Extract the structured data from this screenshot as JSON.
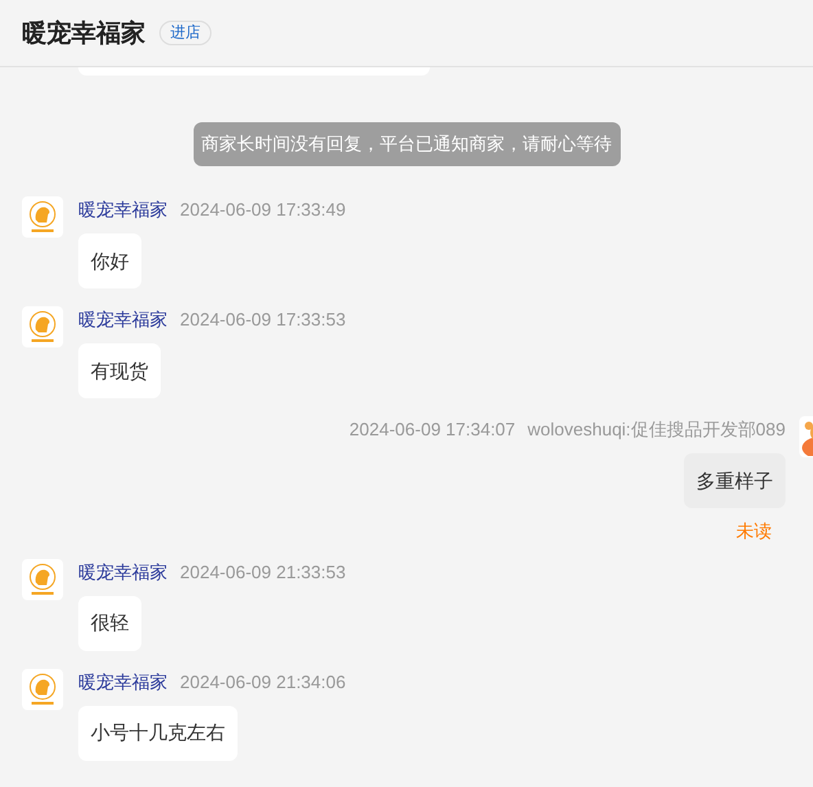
{
  "header": {
    "title": "暖宠幸福家",
    "shop_button": "进店"
  },
  "messages": [
    {
      "kind": "notice",
      "text": "商家长时间没有回复，平台已通知商家，请耐心等待"
    },
    {
      "kind": "shop",
      "sender": "暖宠幸福家",
      "time": "2024-06-09 17:33:49",
      "text": "你好"
    },
    {
      "kind": "shop",
      "sender": "暖宠幸福家",
      "time": "2024-06-09 17:33:53",
      "text": "有现货"
    },
    {
      "kind": "self",
      "sender": "woloveshuqi:促佳搜品开发部089",
      "time": "2024-06-09 17:34:07",
      "text": "多重样子",
      "status": "未读"
    },
    {
      "kind": "shop",
      "sender": "暖宠幸福家",
      "time": "2024-06-09 21:33:53",
      "text": "很轻"
    },
    {
      "kind": "shop",
      "sender": "暖宠幸福家",
      "time": "2024-06-09 21:34:06",
      "text": "小号十几克左右"
    }
  ]
}
